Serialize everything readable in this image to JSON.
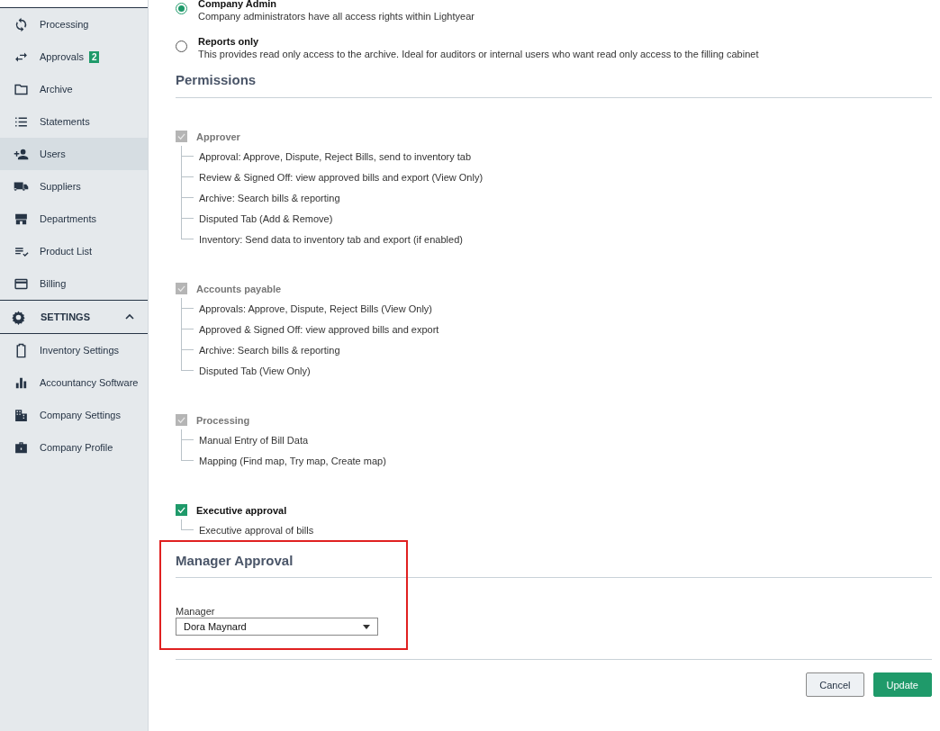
{
  "sidebar": {
    "items": [
      {
        "label": "Processing",
        "selected": false
      },
      {
        "label": "Approvals",
        "selected": false,
        "badge": "2"
      },
      {
        "label": "Archive",
        "selected": false
      },
      {
        "label": "Statements",
        "selected": false
      },
      {
        "label": "Users",
        "selected": true
      },
      {
        "label": "Suppliers",
        "selected": false
      },
      {
        "label": "Departments",
        "selected": false
      },
      {
        "label": "Product List",
        "selected": false
      },
      {
        "label": "Billing",
        "selected": false
      }
    ],
    "settings": {
      "title": "SETTINGS",
      "expanded": true,
      "items": [
        {
          "label": "Inventory Settings",
          "selected": false
        },
        {
          "label": "Accountancy Software",
          "selected": false
        },
        {
          "label": "Company Settings",
          "selected": false
        },
        {
          "label": "Company Profile",
          "selected": false
        }
      ]
    }
  },
  "roles": [
    {
      "title": "Company Admin",
      "description": "Company administrators have all access rights within Lightyear",
      "selected": true
    },
    {
      "title": "Reports only",
      "description": "This provides read only access to the archive. Ideal for auditors or internal users who want read only access to the filling cabinet",
      "selected": false
    }
  ],
  "permissions": {
    "title": "Permissions",
    "groups": [
      {
        "label": "Approver",
        "checked": true,
        "disabled": true,
        "items": [
          "Approval: Approve, Dispute, Reject Bills, send to inventory tab",
          "Review & Signed Off: view approved bills and export (View Only)",
          "Archive: Search bills & reporting",
          "Disputed Tab (Add & Remove)",
          "Inventory: Send data to inventory tab and export (if enabled)"
        ]
      },
      {
        "label": "Accounts payable",
        "checked": true,
        "disabled": true,
        "items": [
          "Approvals: Approve, Dispute, Reject Bills (View Only)",
          "Approved & Signed Off: view approved bills and export",
          "Archive: Search bills & reporting",
          "Disputed Tab (View Only)"
        ]
      },
      {
        "label": "Processing",
        "checked": true,
        "disabled": true,
        "items": [
          "Manual Entry of Bill Data",
          "Mapping (Find map, Try map, Create map)"
        ]
      },
      {
        "label": "Executive approval",
        "checked": true,
        "disabled": false,
        "items": [
          "Executive approval of bills"
        ]
      }
    ]
  },
  "manager_approval": {
    "title": "Manager Approval",
    "highlighted": true,
    "field_label": "Manager",
    "value": "Dora Maynard"
  },
  "buttons": [
    {
      "label": "Cancel",
      "kind": "secondary"
    },
    {
      "label": "Update",
      "kind": "primary"
    }
  ]
}
